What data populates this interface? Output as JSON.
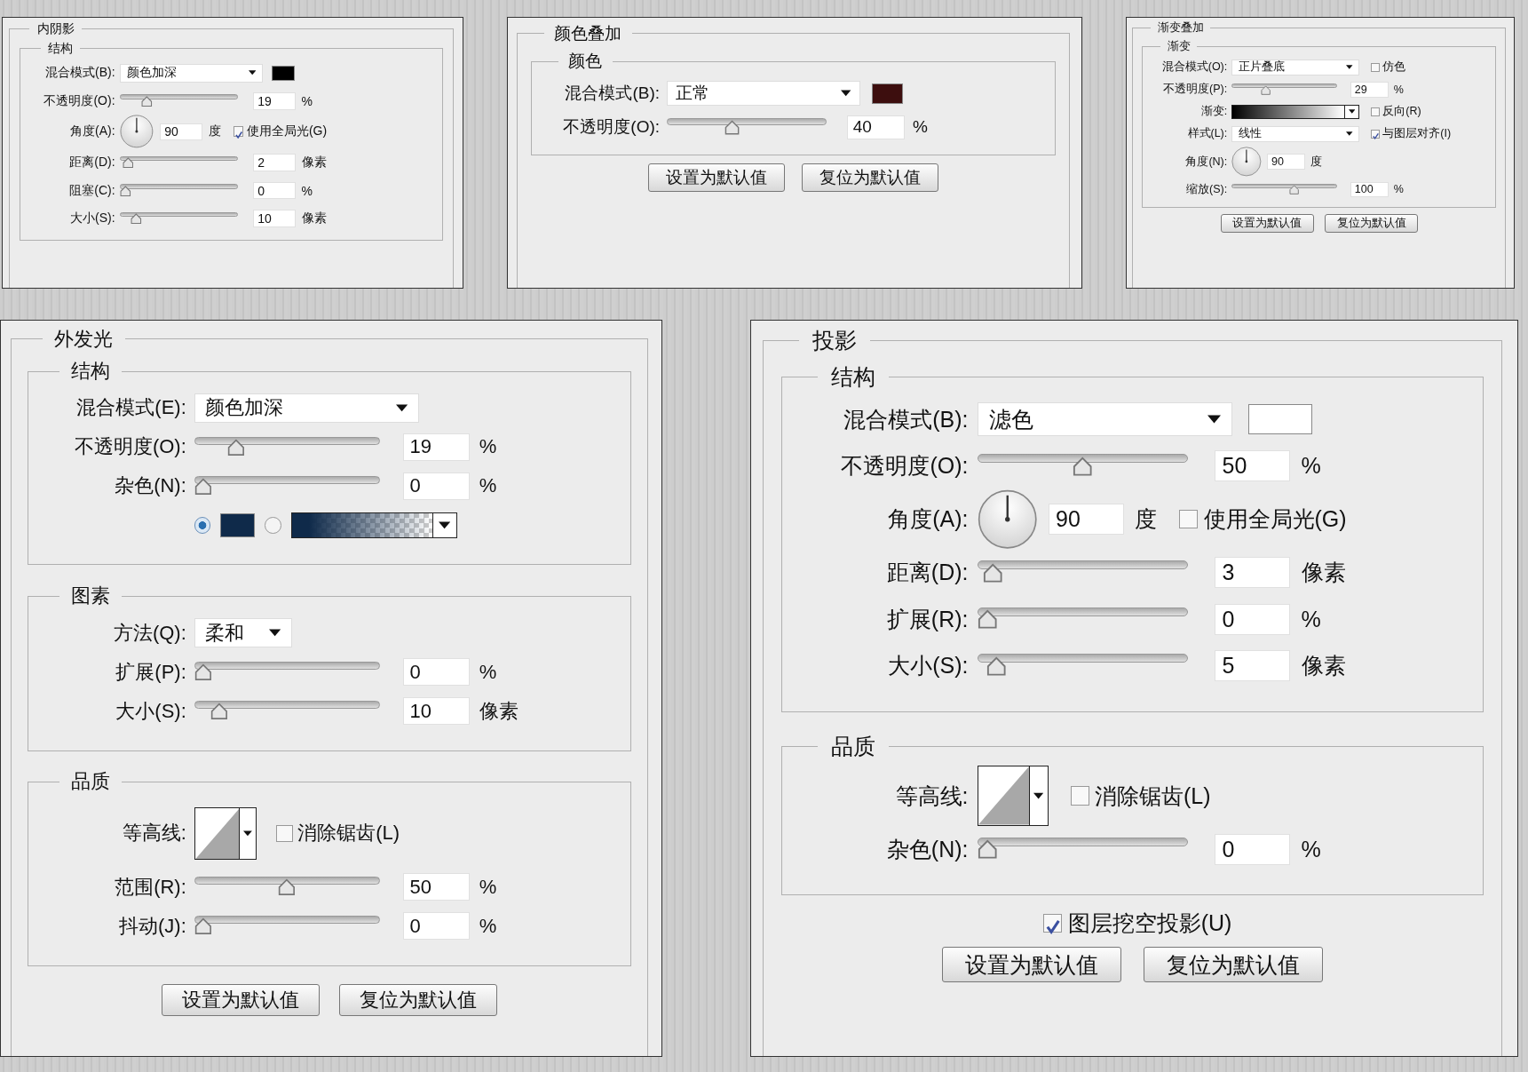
{
  "panels": [
    {
      "title": "内阴影",
      "sections": [
        {
          "title": "结构",
          "rows": [
            {
              "kind": "select",
              "label": "混合模式(B):",
              "value": "颜色加深",
              "swatch": {
                "color": "#000000"
              }
            },
            {
              "kind": "slider",
              "label": "不透明度(O):",
              "level": 0.2,
              "value": "19",
              "unit": "%"
            },
            {
              "kind": "angle",
              "label": "角度(A):",
              "value": "90",
              "unit": "度",
              "checkbox": {
                "label": "使用全局光(G)",
                "checked": true
              }
            },
            {
              "kind": "slider",
              "label": "距离(D):",
              "level": 0.02,
              "value": "2",
              "unit": "像素"
            },
            {
              "kind": "slider",
              "label": "阻塞(C):",
              "level": 0,
              "value": "0",
              "unit": "%"
            },
            {
              "kind": "slider",
              "label": "大小(S):",
              "level": 0.1,
              "value": "10",
              "unit": "像素"
            }
          ]
        }
      ]
    },
    {
      "title": "颜色叠加",
      "sections": [
        {
          "title": "颜色",
          "rows": [
            {
              "kind": "select",
              "label": "混合模式(B):",
              "value": "正常",
              "swatch": {
                "color": "#3d0e0e"
              }
            },
            {
              "kind": "slider",
              "label": "不透明度(O):",
              "level": 0.4,
              "value": "40",
              "unit": "%"
            }
          ]
        }
      ],
      "buttons": [
        "设置为默认值",
        "复位为默认值"
      ]
    },
    {
      "title": "渐变叠加",
      "sections": [
        {
          "title": "渐变",
          "rows": [
            {
              "kind": "select",
              "label": "混合模式(O):",
              "value": "正片叠底",
              "checkbox": {
                "label": "仿色",
                "checked": false
              }
            },
            {
              "kind": "slider",
              "label": "不透明度(P):",
              "level": 0.3,
              "value": "29",
              "unit": "%"
            },
            {
              "kind": "gradient",
              "label": "渐变:",
              "checkbox": {
                "label": "反向(R)",
                "checked": false
              }
            },
            {
              "kind": "select",
              "label": "样式(L):",
              "value": "线性",
              "checkbox": {
                "label": "与图层对齐(I)",
                "checked": true
              }
            },
            {
              "kind": "angle",
              "label": "角度(N):",
              "value": "90",
              "unit": "度"
            },
            {
              "kind": "slider",
              "label": "缩放(S):",
              "level": 0.6,
              "value": "100",
              "unit": "%"
            }
          ]
        }
      ],
      "buttons": [
        "设置为默认值",
        "复位为默认值"
      ]
    },
    {
      "title": "外发光",
      "sections": [
        {
          "title": "结构",
          "rows": [
            {
              "kind": "select",
              "label": "混合模式(E):",
              "value": "颜色加深"
            },
            {
              "kind": "slider",
              "label": "不透明度(O):",
              "level": 0.2,
              "value": "19",
              "unit": "%"
            },
            {
              "kind": "slider",
              "label": "杂色(N):",
              "level": 0,
              "value": "0",
              "unit": "%"
            },
            {
              "kind": "color_choice",
              "options": [
                {
                  "kind": "solid",
                  "selected": true,
                  "color": "#0f2a4a"
                },
                {
                  "kind": "gradient",
                  "selected": false,
                  "color": "#0f2a4a"
                }
              ]
            }
          ]
        },
        {
          "title": "图素",
          "rows": [
            {
              "kind": "short_select",
              "label": "方法(Q):",
              "value": "柔和"
            },
            {
              "kind": "slider",
              "label": "扩展(P):",
              "level": 0,
              "value": "0",
              "unit": "%"
            },
            {
              "kind": "slider",
              "label": "大小(S):",
              "level": 0.1,
              "value": "10",
              "unit": "像素"
            }
          ]
        },
        {
          "title": "品质",
          "rows": [
            {
              "kind": "contour",
              "label": "等高线:",
              "checkbox": {
                "label": "消除锯齿(L)",
                "checked": false
              }
            },
            {
              "kind": "slider",
              "label": "范围(R):",
              "level": 0.5,
              "value": "50",
              "unit": "%"
            },
            {
              "kind": "slider",
              "label": "抖动(J):",
              "level": 0,
              "value": "0",
              "unit": "%"
            }
          ]
        }
      ],
      "buttons": [
        "设置为默认值",
        "复位为默认值"
      ]
    },
    {
      "title": "投影",
      "sections": [
        {
          "title": "结构",
          "rows": [
            {
              "kind": "select",
              "label": "混合模式(B):",
              "value": "滤色",
              "swatch": {
                "color": "#ffffff"
              }
            },
            {
              "kind": "slider",
              "label": "不透明度(O):",
              "level": 0.5,
              "value": "50",
              "unit": "%"
            },
            {
              "kind": "angle",
              "label": "角度(A):",
              "value": "90",
              "unit": "度",
              "checkbox": {
                "label": "使用全局光(G)",
                "checked": false
              }
            },
            {
              "kind": "slider",
              "label": "距离(D):",
              "level": 0.03,
              "value": "3",
              "unit": "像素"
            },
            {
              "kind": "slider",
              "label": "扩展(R):",
              "level": 0,
              "value": "0",
              "unit": "%"
            },
            {
              "kind": "slider",
              "label": "大小(S):",
              "level": 0.05,
              "value": "5",
              "unit": "像素"
            }
          ]
        },
        {
          "title": "品质",
          "rows": [
            {
              "kind": "contour",
              "label": "等高线:",
              "checkbox": {
                "label": "消除锯齿(L)",
                "checked": false
              }
            },
            {
              "kind": "slider",
              "label": "杂色(N):",
              "level": 0,
              "value": "0",
              "unit": "%"
            }
          ]
        }
      ],
      "footer_checkbox": {
        "label": "图层挖空投影(U)",
        "checked": true
      },
      "buttons": [
        "设置为默认值",
        "复位为默认值"
      ]
    }
  ]
}
